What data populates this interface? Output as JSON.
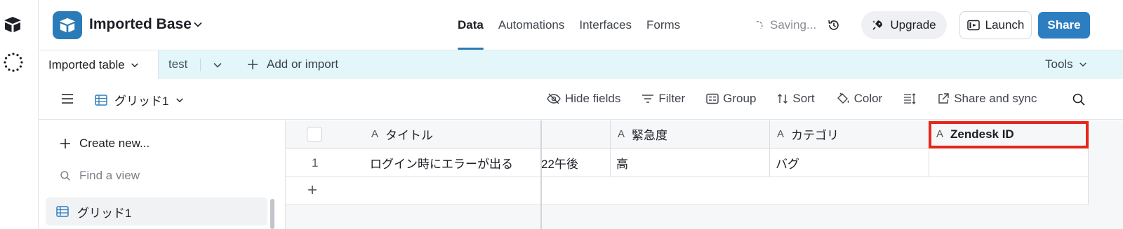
{
  "header": {
    "base_name": "Imported Base",
    "nav_tabs": [
      "Data",
      "Automations",
      "Interfaces",
      "Forms"
    ],
    "saving_text": "Saving...",
    "upgrade_label": "Upgrade",
    "launch_label": "Launch",
    "share_label": "Share"
  },
  "tables": {
    "active_table": "Imported table",
    "other_table": "test",
    "add_import_label": "Add or import",
    "tools_label": "Tools"
  },
  "viewbar": {
    "view_name": "グリッド1",
    "hide_fields": "Hide fields",
    "filter": "Filter",
    "group": "Group",
    "sort": "Sort",
    "color": "Color",
    "share_sync": "Share and sync"
  },
  "sidebar": {
    "create_new": "Create new...",
    "find_view_placeholder": "Find a view",
    "views": [
      "グリッド1"
    ]
  },
  "grid": {
    "columns": [
      "タイトル",
      "",
      "緊急度",
      "カテゴリ",
      "Zendesk ID"
    ],
    "rows": [
      {
        "num": "1",
        "title": "ログイン時にエラーが出る",
        "date": "22午後",
        "urgency": "高",
        "category": "バグ",
        "zendesk": ""
      }
    ],
    "add_row": "+"
  },
  "colors": {
    "accent": "#2d7ec0",
    "tabs_bg": "#e3f7fb",
    "highlight": "#e5271c"
  }
}
